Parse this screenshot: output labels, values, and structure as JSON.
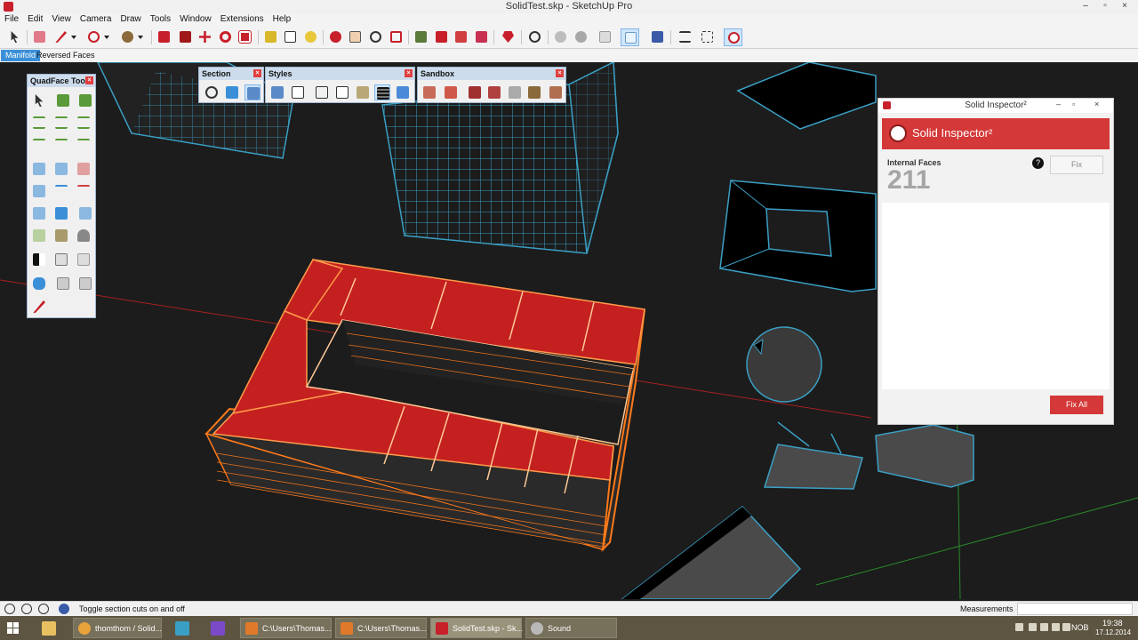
{
  "window": {
    "title": "SolidTest.skp - SketchUp Pro",
    "controls": [
      "–",
      "▫",
      "×"
    ]
  },
  "menu": [
    "File",
    "Edit",
    "View",
    "Camera",
    "Draw",
    "Tools",
    "Window",
    "Extensions",
    "Help"
  ],
  "scene_tabs": [
    "Manifold",
    "Reversed Faces"
  ],
  "panels": {
    "quadface": {
      "title": "QuadFace Tools"
    },
    "section": {
      "title": "Section"
    },
    "styles": {
      "title": "Styles"
    },
    "sandbox": {
      "title": "Sandbox"
    },
    "close_glyph": "×"
  },
  "inspector": {
    "window_title": "Solid Inspector²",
    "banner_title": "Solid Inspector²",
    "controls": [
      "–",
      "▫",
      "×"
    ],
    "error_label": "Internal Faces",
    "error_count": "211",
    "help_glyph": "?",
    "fix_label": "Fix",
    "fix_all_label": "Fix All"
  },
  "status": {
    "message": "Toggle section cuts on and off",
    "measurements_label": "Measurements"
  },
  "taskbar": {
    "tasks": [
      {
        "label": "thomthom / Solid...",
        "icon_color": "#e8a33a"
      },
      {
        "label": "C:\\Users\\Thomas...",
        "icon_color": "#e07a2a"
      },
      {
        "label": "C:\\Users\\Thomas...",
        "icon_color": "#e07a2a"
      },
      {
        "label": "SolidTest.skp - Sk...",
        "icon_color": "#c8202a"
      },
      {
        "label": "Sound",
        "icon_color": "#b8b8b8"
      }
    ],
    "language": "NOB",
    "time": "19:38",
    "date": "17.12.2014"
  },
  "colors": {
    "accent_red": "#d43838",
    "selection_orange": "#ff7a1a",
    "wire_blue": "#3a9fc4",
    "face_red": "#c42020"
  }
}
